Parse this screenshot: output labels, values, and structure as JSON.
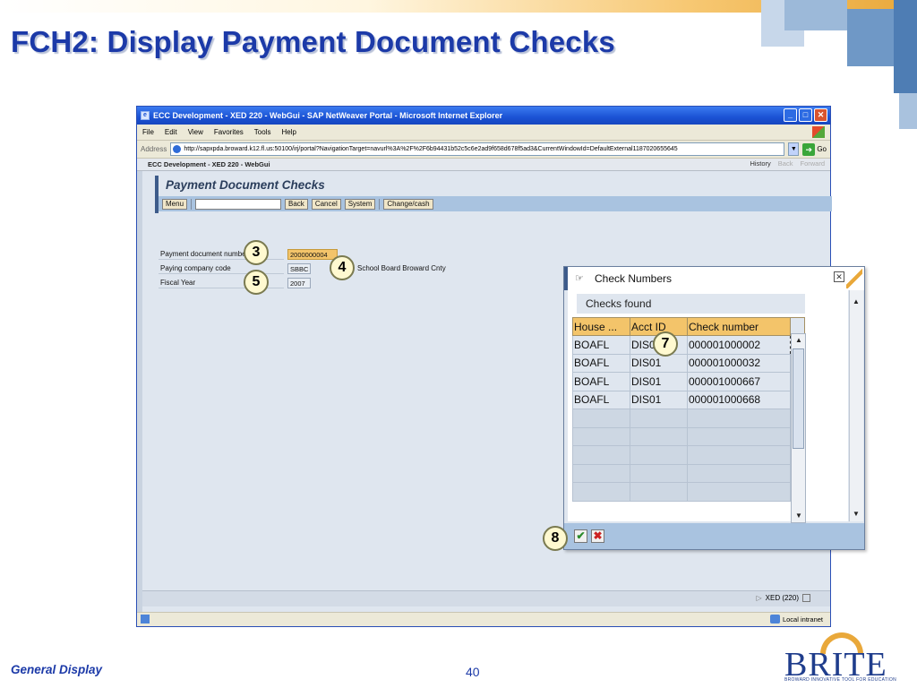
{
  "slide": {
    "title": "FCH2: Display Payment Document Checks",
    "footer_left": "General Display",
    "page_number": "40",
    "logo_text": "BRITE",
    "logo_tagline": "BROWARD INNOVATIVE TOOL FOR EDUCATION",
    "colors": {
      "title": "#1c3aa8",
      "accent": "#e9a83a"
    }
  },
  "browser": {
    "title": "ECC Development - XED 220 - WebGui - SAP NetWeaver Portal - Microsoft Internet Explorer",
    "menu": [
      "File",
      "Edit",
      "View",
      "Favorites",
      "Tools",
      "Help"
    ],
    "address_label": "Address",
    "url": "http://sapxpda.broward.k12.fl.us:50100/irj/portal?NavigationTarget=navurl%3A%2F%2F6b94431b52c5c6e2ad9f658d678f5ad3&CurrentWindowId=DefaultExternal1187020655645",
    "go_label": "Go",
    "status_zone": "Local intranet"
  },
  "portal": {
    "header": "ECC Development - XED 220 - WebGui",
    "history": "History",
    "back": "Back",
    "forward": "Forward"
  },
  "sap": {
    "screen_title": "Payment Document Checks",
    "toolbar": {
      "menu": "Menu",
      "back": "Back",
      "cancel": "Cancel",
      "system": "System",
      "change_cash": "Change/cash"
    },
    "fields": [
      {
        "label": "Payment document number",
        "value": "2000000004",
        "extra": ""
      },
      {
        "label": "Paying company code",
        "value": "SBBC",
        "extra": "School Board Broward Cnty"
      },
      {
        "label": "Fiscal Year",
        "value": "2007",
        "extra": ""
      }
    ],
    "system_info": "XED (220)"
  },
  "dialog": {
    "title": "Check Numbers",
    "section": "Checks found",
    "columns": [
      "House ...",
      "Acct ID",
      "Check number"
    ],
    "rows": [
      [
        "BOAFL",
        "DIS01",
        "000001000002"
      ],
      [
        "BOAFL",
        "DIS01",
        "000001000032"
      ],
      [
        "BOAFL",
        "DIS01",
        "000001000667"
      ],
      [
        "BOAFL",
        "DIS01",
        "000001000668"
      ]
    ],
    "empty_rows": 5
  },
  "callouts": [
    "3",
    "4",
    "5",
    "7",
    "8"
  ]
}
